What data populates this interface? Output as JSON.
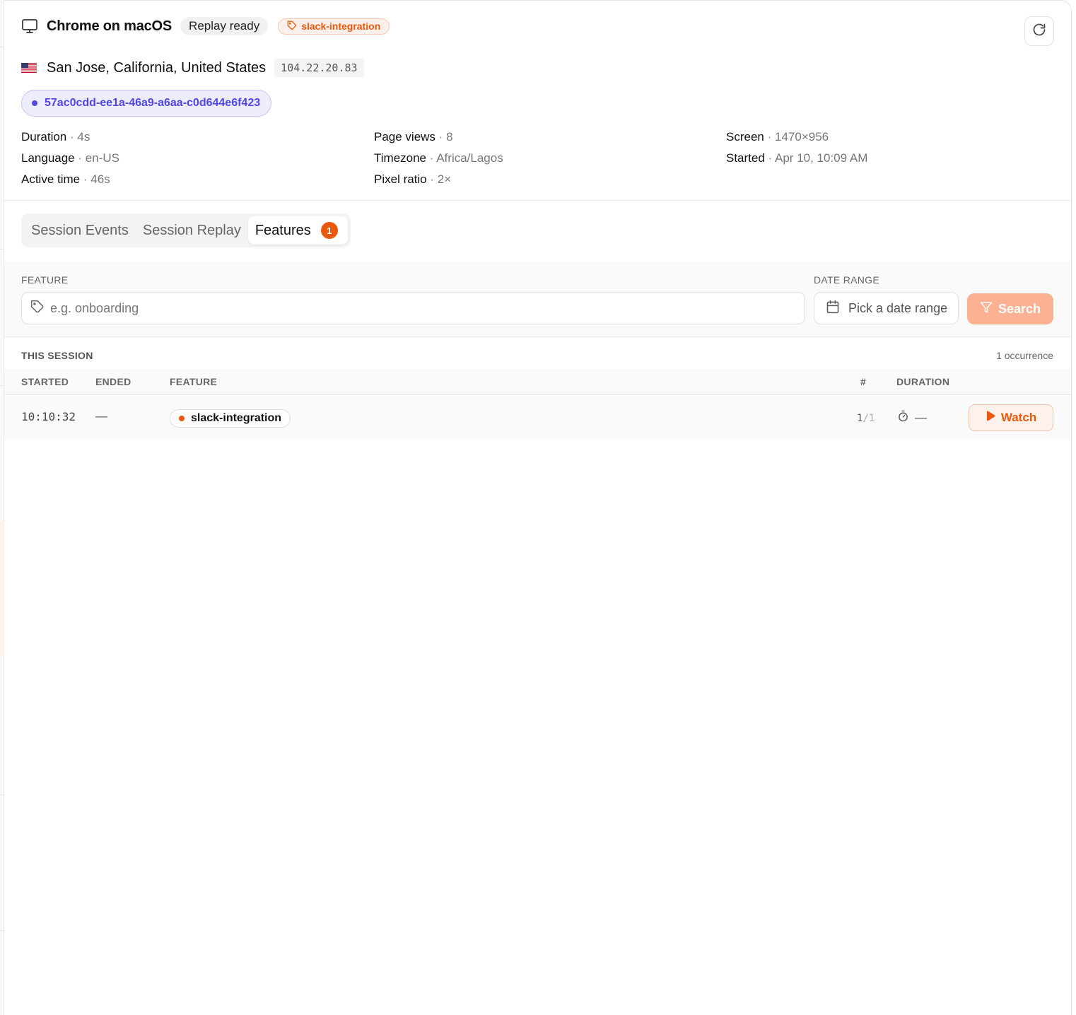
{
  "session": {
    "browser_title": "Chrome on macOS",
    "replay_status": "Replay ready",
    "feature_tag": "slack-integration",
    "location": "San Jose, California, United States",
    "ip": "104.22.20.83",
    "session_id": "57ac0cdd-ee1a-46a9-a6aa-c0d644e6f423",
    "icons": {
      "device": "monitor-icon",
      "tag": "tag-icon",
      "refresh": "refresh-icon",
      "flag": "us-flag-icon"
    }
  },
  "meta": {
    "col1": [
      {
        "label": "Duration",
        "sep": "·",
        "value": "4s"
      },
      {
        "label": "Language",
        "sep": "·",
        "value": "en-US"
      },
      {
        "label": "Active time",
        "sep": "·",
        "value": "46s"
      }
    ],
    "col2": [
      {
        "label": "Page views",
        "sep": "·",
        "value": "8"
      },
      {
        "label": "Timezone",
        "sep": "·",
        "value": "Africa/Lagos"
      },
      {
        "label": "Pixel ratio",
        "sep": "·",
        "value": "2×"
      }
    ],
    "col3": [
      {
        "label": "Screen",
        "sep": "·",
        "value": "1470×956"
      },
      {
        "label": "Started",
        "sep": "·",
        "value": "Apr 10, 10:09 AM"
      }
    ]
  },
  "tabs": [
    {
      "label": "Session Events",
      "active": false
    },
    {
      "label": "Session Replay",
      "active": false
    },
    {
      "label": "Features",
      "active": true,
      "badge": "1"
    }
  ],
  "filters": {
    "feature_label": "FEATURE",
    "feature_placeholder": "e.g. onboarding",
    "feature_value": "",
    "date_label": "DATE RANGE",
    "date_placeholder": "Pick a date range",
    "search_label": "Search",
    "icons": {
      "feature": "tag-icon",
      "date": "calendar-icon",
      "search": "filter-icon"
    }
  },
  "table": {
    "section_title": "THIS SESSION",
    "occurrences": "1 occurrence",
    "columns": {
      "started": "STARTED",
      "ended": "ENDED",
      "feature": "FEATURE",
      "count": "#",
      "duration": "DURATION"
    },
    "rows": [
      {
        "started": "10:10:32",
        "ended": "—",
        "feature": "slack-integration",
        "count": "1",
        "count_sep": "/",
        "count_total": "1",
        "duration": "—",
        "action": "Watch"
      }
    ]
  },
  "colors": {
    "accent": "#ea580c",
    "accent_soft": "#fcb292",
    "session_id": "#4f46e5"
  }
}
